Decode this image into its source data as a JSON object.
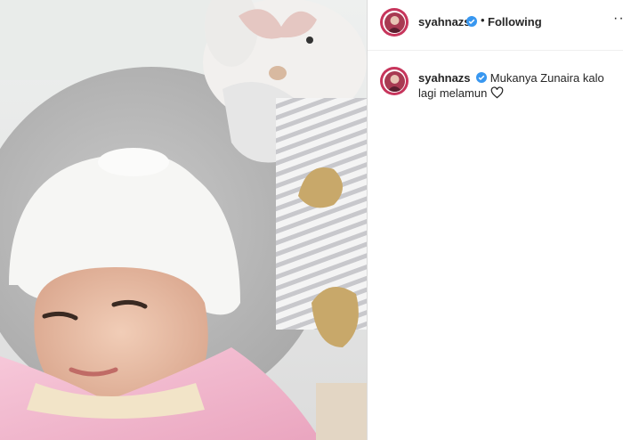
{
  "post": {
    "author": {
      "username": "syahnazs",
      "verified": true
    },
    "follow_status": "Following",
    "separator": "•",
    "more_icon": "more-horizontal-icon",
    "caption": {
      "line1": "Mukanya Zunaira kalo",
      "line2": "lagi melamun"
    }
  },
  "colors": {
    "text": "#262626",
    "verified_badge": "#3897f0",
    "story_ring": "#c7355c",
    "border": "#dbdbdb"
  }
}
